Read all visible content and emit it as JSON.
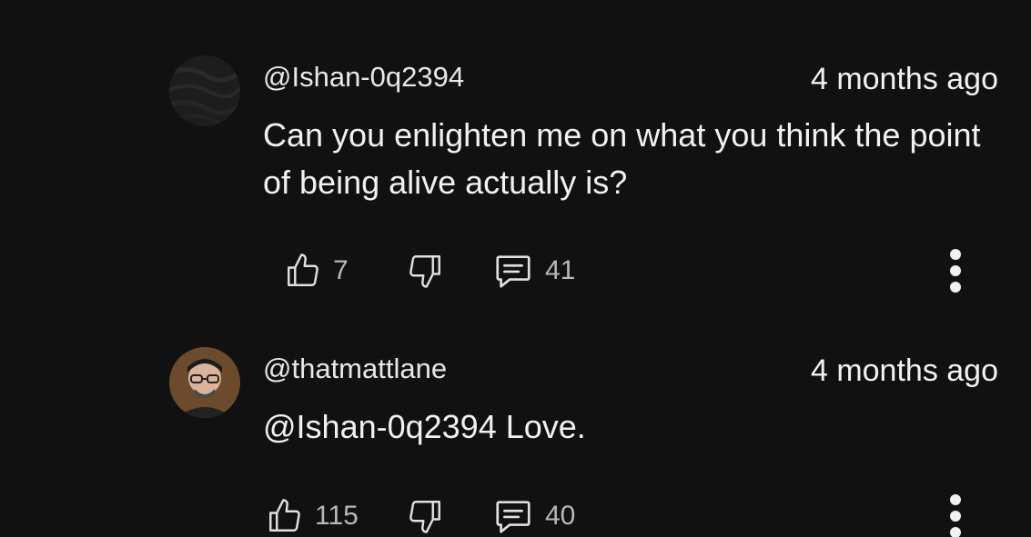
{
  "comments": [
    {
      "handle": "@Ishan-0q2394",
      "timestamp": "4 months ago",
      "text": "Can you enlighten me on what you think the point of being alive actually is?",
      "likes": "7",
      "replies": "41",
      "avatar_icon": "dark-texture-avatar"
    },
    {
      "handle": "@thatmattlane",
      "timestamp": "4 months ago",
      "text": "@Ishan-0q2394 Love.",
      "likes": "115",
      "replies": "40",
      "avatar_icon": "person-with-glasses-avatar"
    }
  ],
  "icons": {
    "like": "thumbs-up-icon",
    "dislike": "thumbs-down-icon",
    "reply": "comment-icon",
    "more": "more-vertical-icon"
  },
  "colors": {
    "background": "#111111",
    "text": "#f1f1f1",
    "secondary_text": "#b8b8b8"
  }
}
